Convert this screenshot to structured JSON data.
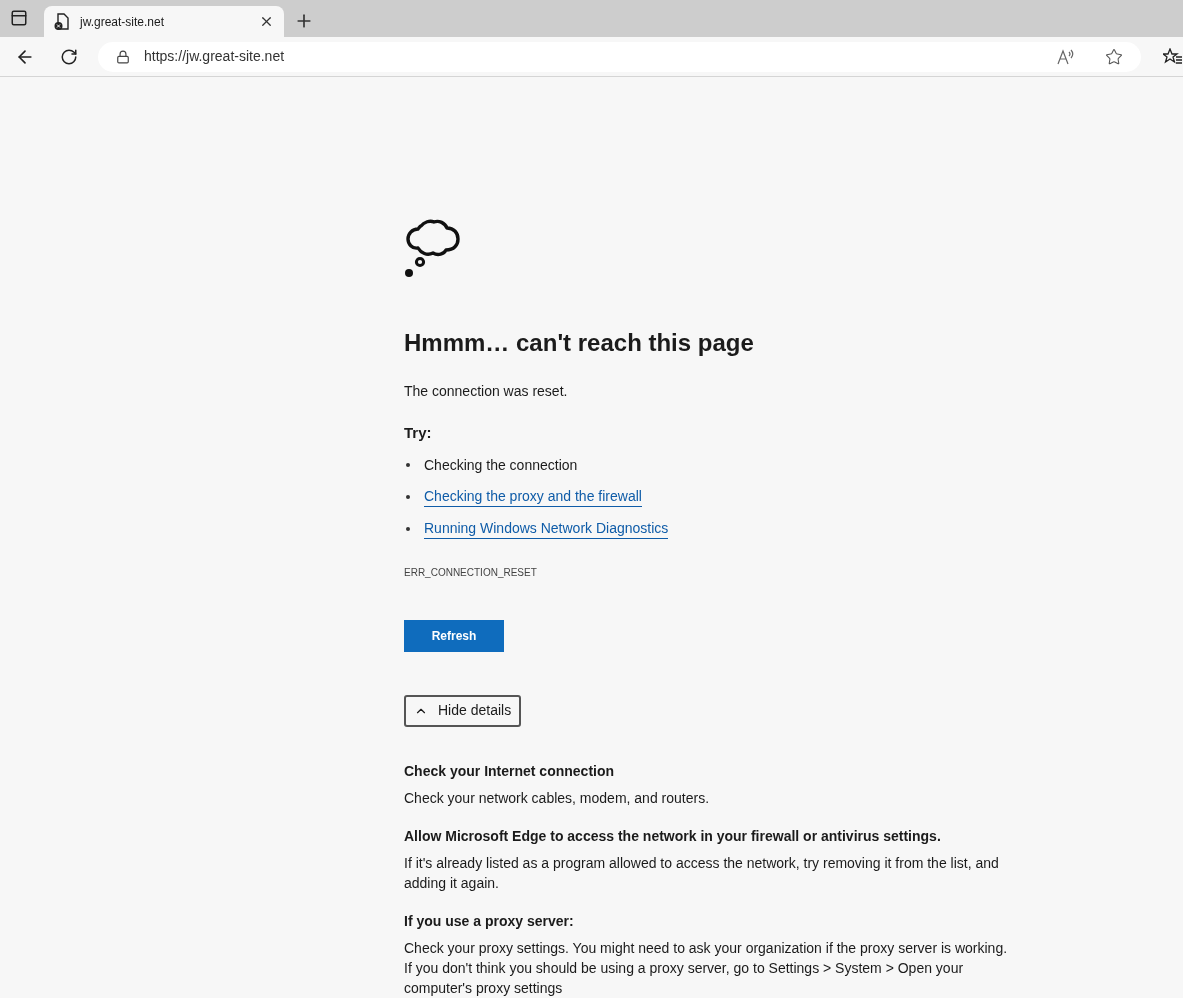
{
  "tabs": [
    {
      "title": "jw.great-site.net",
      "selected": true
    }
  ],
  "address_bar": {
    "url": "https://jw.great-site.net"
  },
  "error_page": {
    "heading": "Hmmm… can't reach this page",
    "message": "The connection was reset.",
    "try_label": "Try:",
    "suggestions": [
      {
        "text": "Checking the connection",
        "kind": "text"
      },
      {
        "text": "Checking the proxy and the firewall",
        "kind": "link"
      },
      {
        "text": "Running Windows Network Diagnostics",
        "kind": "link"
      }
    ],
    "error_code": "ERR_CONNECTION_RESET",
    "refresh_button": "Refresh",
    "details_toggle": {
      "label": "Hide details",
      "expanded": true
    },
    "details": [
      {
        "title": "Check your Internet connection",
        "body": "Check your network cables, modem, and routers."
      },
      {
        "title": "Allow Microsoft Edge to access the network in your firewall or antivirus settings.",
        "body": "If it's already listed as a program allowed to access the network, try removing it from the list, and adding it again."
      },
      {
        "title": "If you use a proxy server:",
        "body": "Check your proxy settings. You might need to ask your organization if the proxy server is working. If you don't think you should be using a proxy server, go to Settings > System > Open your computer's proxy settings"
      }
    ]
  }
}
